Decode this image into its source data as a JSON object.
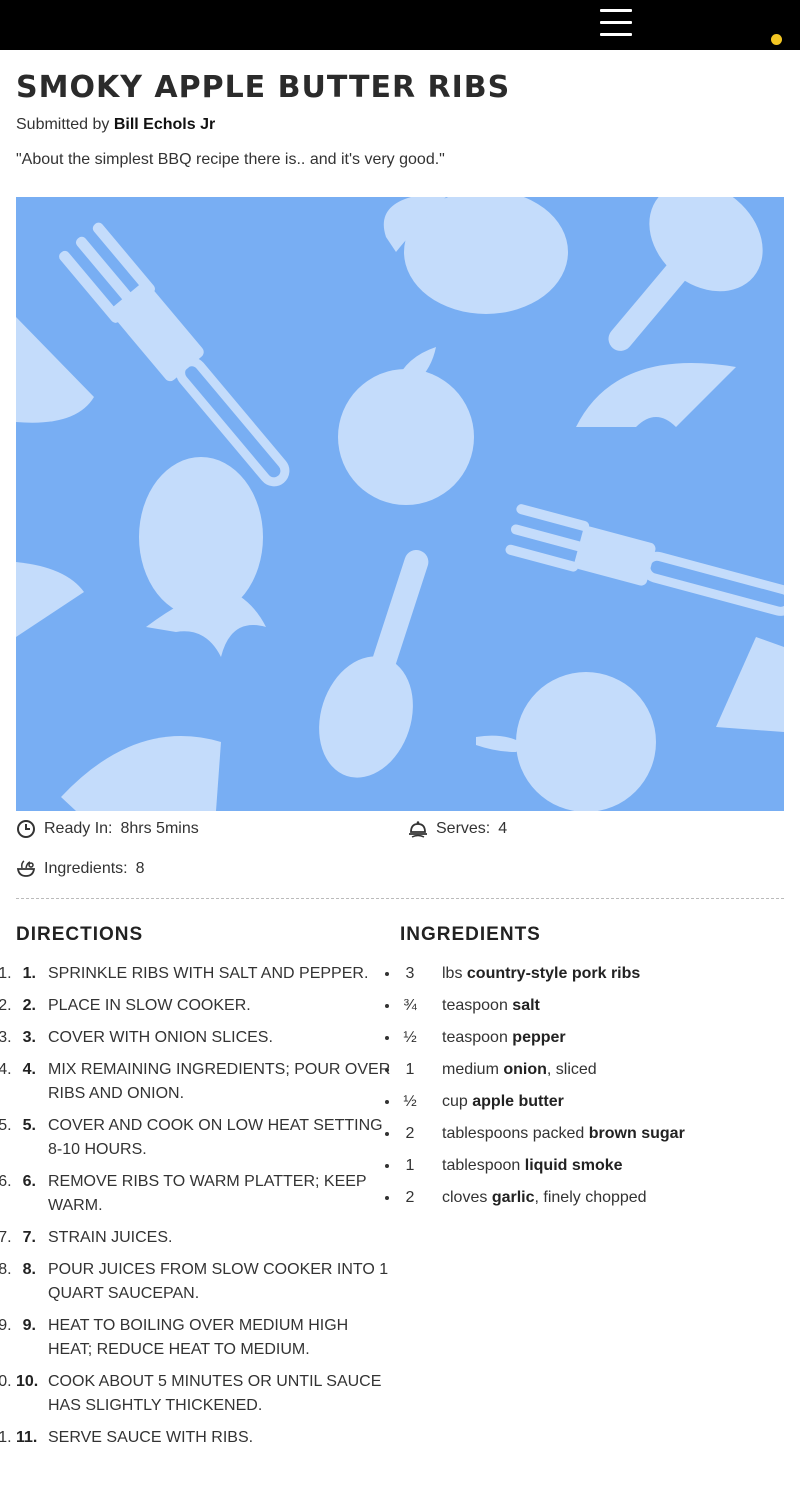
{
  "recipe": {
    "title": "SMOKY APPLE BUTTER RIBS",
    "submitted_prefix": "Submitted by",
    "author": "Bill Echols Jr",
    "quote": "\"About the simplest BBQ recipe there is.. and it's very good.\""
  },
  "meta": {
    "ready_label": "Ready In:",
    "ready_value": "8hrs 5mins",
    "serves_label": "Serves:",
    "serves_value": "4",
    "ingredients_label": "Ingredients:",
    "ingredients_value": "8"
  },
  "directions": {
    "heading": "DIRECTIONS",
    "steps": [
      {
        "num": "1.",
        "text": "Sprinkle ribs with salt and pepper."
      },
      {
        "num": "2.",
        "text": "Place in slow cooker."
      },
      {
        "num": "3.",
        "text": "Cover with onion slices."
      },
      {
        "num": "4.",
        "text": "Mix remaining ingredients; pour over ribs and onion."
      },
      {
        "num": "5.",
        "text": "Cover and cook on low heat setting 8-10 hours."
      },
      {
        "num": "6.",
        "text": "Remove ribs to warm platter; keep warm."
      },
      {
        "num": "7.",
        "text": "Strain juices."
      },
      {
        "num": "8.",
        "text": "Pour juices from slow cooker into 1 quart saucepan."
      },
      {
        "num": "9.",
        "text": "Heat to boiling over medium high heat; reduce heat to medium."
      },
      {
        "num": "10.",
        "text": "Cook about 5 minutes or until sauce has slightly thickened."
      },
      {
        "num": "11.",
        "text": "Serve sauce with ribs."
      }
    ]
  },
  "ingredients": {
    "heading": "INGREDIENTS",
    "items": [
      {
        "qty": "3",
        "unit": "lbs",
        "name": "country-style pork ribs",
        "note": ""
      },
      {
        "qty": "¾",
        "unit": "teaspoon",
        "name": "salt",
        "note": ""
      },
      {
        "qty": "½",
        "unit": "teaspoon",
        "name": "pepper",
        "note": ""
      },
      {
        "qty": "1",
        "unit": "medium",
        "name": "onion",
        "note": ", sliced"
      },
      {
        "qty": "½",
        "unit": "cup",
        "name": "apple butter",
        "note": ""
      },
      {
        "qty": "2",
        "unit": "tablespoons packed",
        "name": "brown sugar",
        "note": ""
      },
      {
        "qty": "1",
        "unit": "tablespoon",
        "name": "liquid smoke",
        "note": ""
      },
      {
        "qty": "2",
        "unit": "cloves",
        "name": "garlic",
        "note": ", finely chopped"
      }
    ]
  },
  "colors": {
    "topbar": "#000000",
    "notification_dot": "#f3c623",
    "hero_bg": "#78aef3",
    "hero_shapes": "#c4dcfb"
  },
  "icons": {
    "menu": "hamburger-menu-icon",
    "ready": "clock-icon",
    "serves": "serving-dish-icon",
    "ingredients": "ingredients-bowl-icon"
  }
}
